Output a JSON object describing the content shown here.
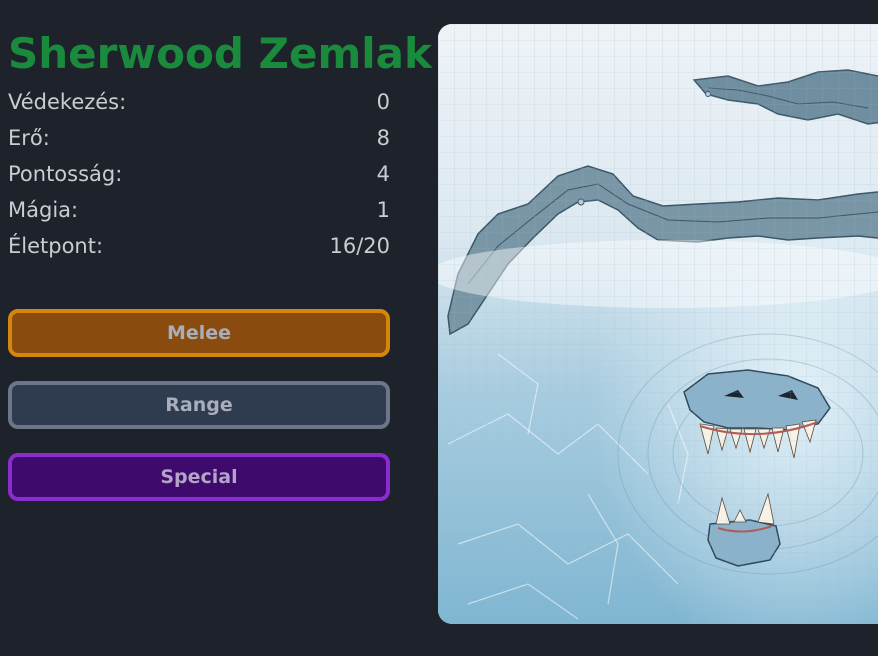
{
  "character": {
    "name": "Sherwood Zemlak",
    "stats": [
      {
        "label": "Védekezés:",
        "value": "0"
      },
      {
        "label": "Erő:",
        "value": "8"
      },
      {
        "label": "Pontosság:",
        "value": "4"
      },
      {
        "label": "Mágia:",
        "value": "1"
      },
      {
        "label": "Életpont:",
        "value": "16/20"
      }
    ]
  },
  "actions": {
    "melee_label": "Melee",
    "range_label": "Range",
    "special_label": "Special"
  },
  "colors": {
    "background": "#1e222a",
    "name": "#1a8a3c",
    "melee": "#d4870a",
    "range": "#6b7788",
    "special": "#8b2ccf"
  },
  "map": {
    "scene": "ice-monster-map"
  }
}
